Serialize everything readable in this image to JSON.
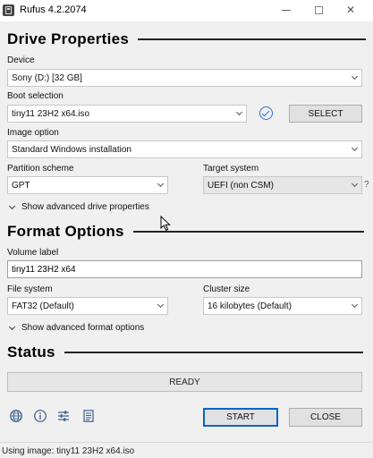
{
  "window": {
    "title": "Rufus 4.2.2074",
    "close_glyph": "✕"
  },
  "drive_properties": {
    "heading": "Drive Properties",
    "device_label": "Device",
    "device_value": "Sony (D:) [32 GB]",
    "boot_selection_label": "Boot selection",
    "boot_selection_value": "tiny11 23H2 x64.iso",
    "select_button": "SELECT",
    "image_option_label": "Image option",
    "image_option_value": "Standard Windows installation",
    "partition_scheme_label": "Partition scheme",
    "partition_scheme_value": "GPT",
    "target_system_label": "Target system",
    "target_system_value": "UEFI (non CSM)",
    "target_help": "?",
    "advanced_toggle": "Show advanced drive properties"
  },
  "format_options": {
    "heading": "Format Options",
    "volume_label_label": "Volume label",
    "volume_label_value": "tiny11 23H2 x64",
    "file_system_label": "File system",
    "file_system_value": "FAT32 (Default)",
    "cluster_size_label": "Cluster size",
    "cluster_size_value": "16 kilobytes (Default)",
    "advanced_toggle": "Show advanced format options"
  },
  "status": {
    "heading": "Status",
    "text": "READY"
  },
  "actions": {
    "start": "START",
    "close": "CLOSE"
  },
  "toolbar_icons": [
    "globe-icon",
    "info-icon",
    "settings-sliders-icon",
    "log-icon"
  ],
  "footer": {
    "text": "Using image: tiny11 23H2 x64.iso"
  },
  "colors": {
    "accent": "#0a64c8",
    "check": "#2a6fd6",
    "background": "#f0f0f0"
  }
}
